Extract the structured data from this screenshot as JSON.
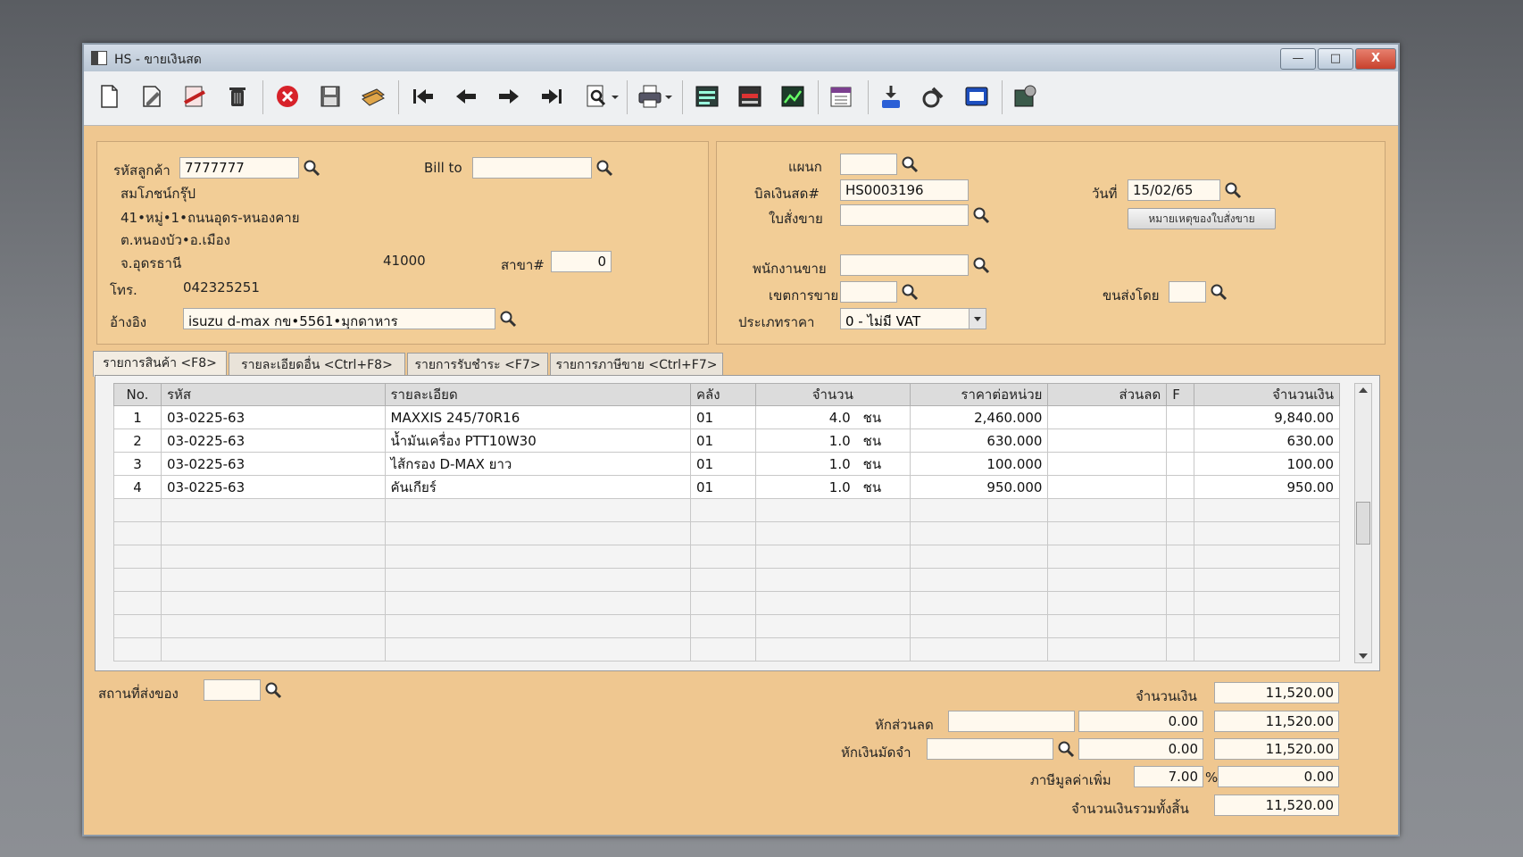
{
  "window": {
    "title": "HS - ขายเงินสด",
    "min_label": "—",
    "max_label": "□",
    "close_label": "X"
  },
  "toolbar": {
    "icons": [
      "new-document-icon",
      "edit-icon",
      "void-icon",
      "trash-icon",
      "cancel-icon",
      "save-icon",
      "money-icon",
      "first-record-icon",
      "previous-record-icon",
      "next-record-icon",
      "last-record-icon",
      "search-document-icon",
      "print-icon",
      "report1-icon",
      "report2-icon",
      "report3-icon",
      "calendar-icon",
      "approve-icon",
      "ok-check-icon",
      "ok-button-icon",
      "settings-icon"
    ]
  },
  "customer": {
    "code_label": "รหัสลูกค้า",
    "code_value": "7777777",
    "bill_to_label": "Bill to",
    "bill_to_value": "",
    "name": "สมโภชน์กรุ๊ป",
    "address1": "41•หมู่•1•ถนนอุดร-หนองคาย",
    "address2": "ต.หนองบัว•อ.เมือง",
    "province": "จ.อุดรธานี",
    "postcode": "41000",
    "branch_label": "สาขา#",
    "branch_value": "0",
    "phone_label": "โทร.",
    "phone_value": "042325251",
    "ref_label": "อ้างอิง",
    "ref_value": "isuzu d-max กข•5561•มุกดาหาร"
  },
  "doc": {
    "dept_label": "แผนก",
    "dept_value": "",
    "bill_label": "บิลเงินสด#",
    "bill_value": "HS0003196",
    "so_label": "ใบสั่งขาย",
    "so_value": "",
    "date_label": "วันที่",
    "date_value": "15/02/65",
    "so_note_button": "หมายเหตุของใบสั่งขาย",
    "salesman_label": "พนักงานขาย",
    "salesman_value": "",
    "area_label": "เขตการขาย",
    "area_value": "",
    "shipper_label": "ขนส่งโดย",
    "shipper_value": "",
    "price_type_label": "ประเภทราคา",
    "price_type_value": "0 - ไม่มี VAT"
  },
  "tabs": [
    "รายการสินค้า <F8>",
    "รายละเอียดอื่น <Ctrl+F8>",
    "รายการรับชำระ <F7>",
    "รายการภาษีขาย <Ctrl+F7>"
  ],
  "grid": {
    "headers": [
      "No.",
      "รหัส",
      "รายละเอียด",
      "คลัง",
      "จำนวน",
      "ราคาต่อหน่วย",
      "ส่วนลด",
      "F",
      "จำนวนเงิน"
    ],
    "rows": [
      {
        "no": "1",
        "code": "03-0225-63",
        "desc": "MAXXIS 245/70R16",
        "wh": "01",
        "qty": "4.0",
        "unit": "ชน",
        "price": "2,460.000",
        "disc": "",
        "f": "",
        "amount": "9,840.00"
      },
      {
        "no": "2",
        "code": "03-0225-63",
        "desc": "น้ำมันเครื่อง PTT10W30",
        "wh": "01",
        "qty": "1.0",
        "unit": "ชน",
        "price": "630.000",
        "disc": "",
        "f": "",
        "amount": "630.00"
      },
      {
        "no": "3",
        "code": "03-0225-63",
        "desc": "ไส้กรอง D-MAX ยาว",
        "wh": "01",
        "qty": "1.0",
        "unit": "ชน",
        "price": "100.000",
        "disc": "",
        "f": "",
        "amount": "100.00"
      },
      {
        "no": "4",
        "code": "03-0225-63",
        "desc": "คันเกียร์",
        "wh": "01",
        "qty": "1.0",
        "unit": "ชน",
        "price": "950.000",
        "disc": "",
        "f": "",
        "amount": "950.00"
      }
    ]
  },
  "footer": {
    "ship_to_label": "สถานที่ส่งของ",
    "ship_to_value": "",
    "amount_label": "จำนวนเงิน",
    "amount_value": "11,520.00",
    "discount_label": "หักส่วนลด",
    "discount_text": "",
    "discount_value": "0.00",
    "discount_total": "11,520.00",
    "deposit_label": "หักเงินมัดจำ",
    "deposit_text": "",
    "deposit_value": "0.00",
    "deposit_total": "11,520.00",
    "vat_label": "ภาษีมูลค่าเพิ่ม",
    "vat_rate": "7.00",
    "vat_pct": "%",
    "vat_value": "0.00",
    "grand_label": "จำนวนเงินรวมทั้งสิ้น",
    "grand_value": "11,520.00"
  }
}
